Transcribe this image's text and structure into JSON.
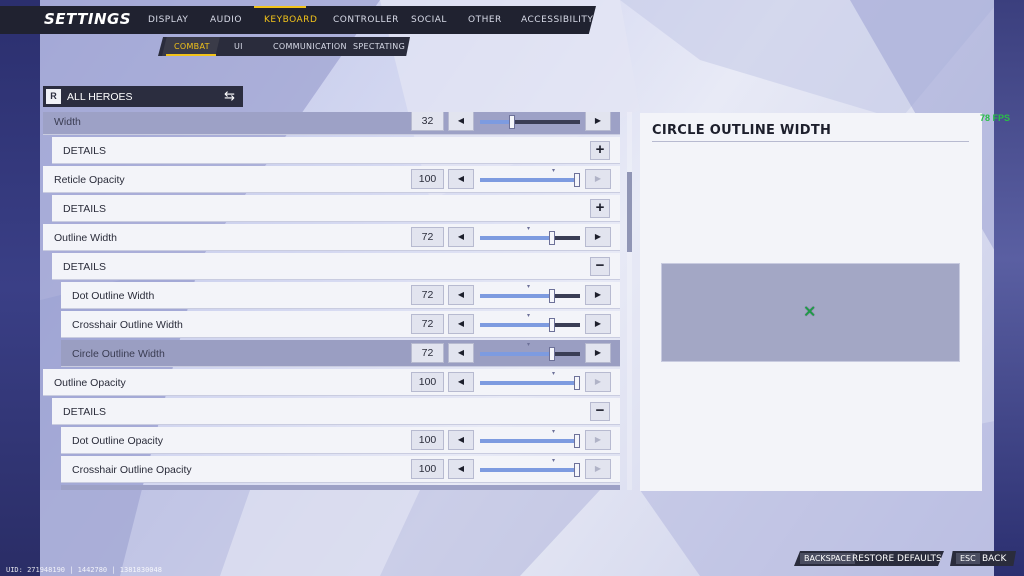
{
  "header": {
    "title": "SETTINGS",
    "tabs": [
      "DISPLAY",
      "AUDIO",
      "KEYBOARD",
      "CONTROLLER",
      "SOCIAL",
      "OTHER",
      "ACCESSIBILITY"
    ],
    "active_tab": "KEYBOARD",
    "subtabs": [
      "COMBAT",
      "UI",
      "COMMUNICATION",
      "SPECTATING"
    ],
    "active_subtab": "COMBAT"
  },
  "hero_select": {
    "logo": "R",
    "label": "ALL HEROES",
    "swap_icon": "⇆"
  },
  "rows": [
    {
      "label": "Width",
      "value": "32",
      "slider": 0.32,
      "mark": false,
      "right_disabled": false,
      "style": "dim"
    },
    {
      "label": "DETAILS",
      "toggle": "+"
    },
    {
      "label": "Reticle Opacity",
      "value": "100",
      "slider": 1.0,
      "mark": true,
      "right_disabled": true
    },
    {
      "label": "DETAILS",
      "toggle": "+"
    },
    {
      "label": "Outline Width",
      "value": "72",
      "slider": 0.72,
      "mark": true,
      "right_disabled": false
    },
    {
      "label": "DETAILS",
      "toggle": "−"
    },
    {
      "label": "Dot Outline Width",
      "value": "72",
      "slider": 0.72,
      "mark": true,
      "right_disabled": false,
      "indent": true
    },
    {
      "label": "Crosshair Outline Width",
      "value": "72",
      "slider": 0.72,
      "mark": true,
      "right_disabled": false,
      "indent": true
    },
    {
      "label": "Circle Outline Width",
      "value": "72",
      "slider": 0.72,
      "mark": true,
      "right_disabled": false,
      "indent": true,
      "style": "selected"
    },
    {
      "label": "Outline Opacity",
      "value": "100",
      "slider": 1.0,
      "mark": true,
      "right_disabled": true
    },
    {
      "label": "DETAILS",
      "toggle": "−"
    },
    {
      "label": "Dot Outline Opacity",
      "value": "100",
      "slider": 1.0,
      "mark": true,
      "right_disabled": true,
      "indent": true
    },
    {
      "label": "Crosshair Outline Opacity",
      "value": "100",
      "slider": 1.0,
      "mark": true,
      "right_disabled": true,
      "indent": true
    }
  ],
  "preview": {
    "title": "CIRCLE OUTLINE WIDTH",
    "crosshair_glyph": "✕"
  },
  "fps": "78 FPS",
  "footer": {
    "backspace_key": "BACKSPACE",
    "restore_label": "RESTORE DEFAULTS",
    "esc_key": "ESC",
    "back_label": "BACK",
    "uid": "UID: 271948190 | 1442780 | 1381830048"
  },
  "colors": {
    "accent": "#f2c31a",
    "fill": "#7d9be0",
    "fps": "#28c046"
  }
}
